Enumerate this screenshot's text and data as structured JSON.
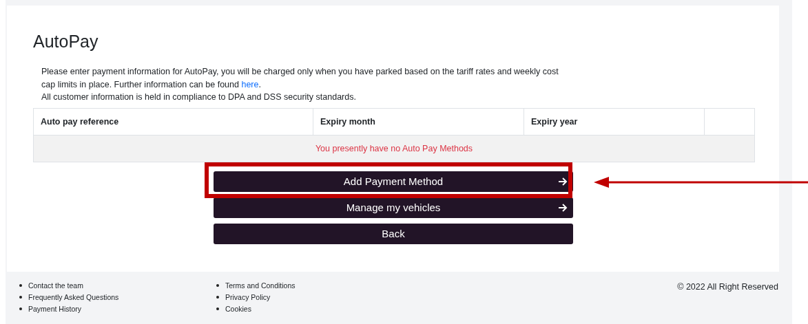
{
  "page": {
    "title": "AutoPay",
    "intro": [
      "Please enter payment information for AutoPay, you will be charged only when you have parked based on the tariff rates and weekly cost cap limits in place. Further information can be found ",
      "here",
      ".",
      "All customer information is held in compliance to DPA and DSS security standards."
    ]
  },
  "table": {
    "columns": [
      "Auto pay reference",
      "Expiry month",
      "Expiry year"
    ],
    "empty_message": "You presently have no Auto Pay Methods"
  },
  "buttons": [
    {
      "label": "Add Payment Method",
      "arrow": true,
      "highlighted": true
    },
    {
      "label": "Manage my vehicles",
      "arrow": true,
      "highlighted": false
    },
    {
      "label": "Back",
      "arrow": false,
      "highlighted": false
    }
  ],
  "footer": {
    "links_1": [
      "Contact the team",
      "Frequently Asked Questions",
      "Payment History"
    ],
    "links_2": [
      "Terms and Conditions",
      "Privacy Policy",
      "Cookies"
    ],
    "copyright": "© 2022 All Right Reserved"
  }
}
